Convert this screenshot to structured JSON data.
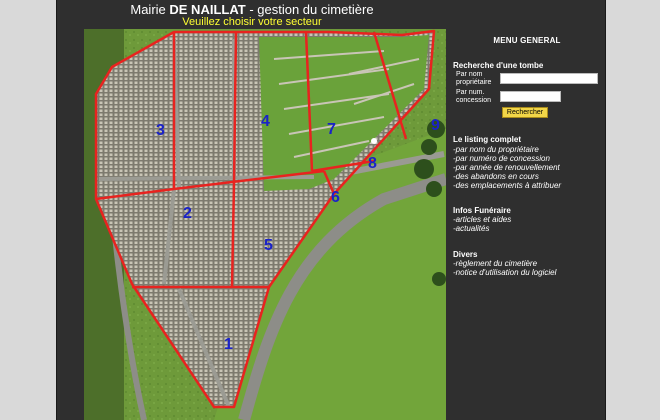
{
  "header": {
    "title_prefix": "Mairie ",
    "title_bold": "DE NAILLAT",
    "title_suffix": " - gestion du cimetière",
    "subtitle": "Veuillez choisir votre secteur"
  },
  "map": {
    "sectors": [
      "1",
      "2",
      "3",
      "4",
      "5",
      "6",
      "7",
      "8",
      "9"
    ],
    "outline_color": "#e8231f",
    "label_color": "#1a22c8"
  },
  "menu": {
    "title": "MENU GENERAL",
    "search": {
      "title": "Recherche d'une tombe",
      "owner_label_1": "Par nom",
      "owner_label_2": "propriétaire",
      "concession_label_1": "Par num.",
      "concession_label_2": "concession",
      "button": "Rechercher"
    },
    "listing": {
      "title": "Le listing complet",
      "items": [
        "-par nom du propriétaire",
        "-par numéro de concession",
        "-par année de renouvellement",
        "-des abandons en cours",
        "-des emplacements à attribuer"
      ]
    },
    "funeral": {
      "title": "Infos Funéraire",
      "items": [
        "-articles et aides",
        "-actualités"
      ]
    },
    "misc": {
      "title": "Divers",
      "items": [
        "-règlement du cimetière",
        "-notice d'utilisation du logiciel"
      ]
    }
  },
  "colors": {
    "background": "#2f2f2f",
    "subtitle": "#ffff33",
    "button": "#f2d648"
  }
}
